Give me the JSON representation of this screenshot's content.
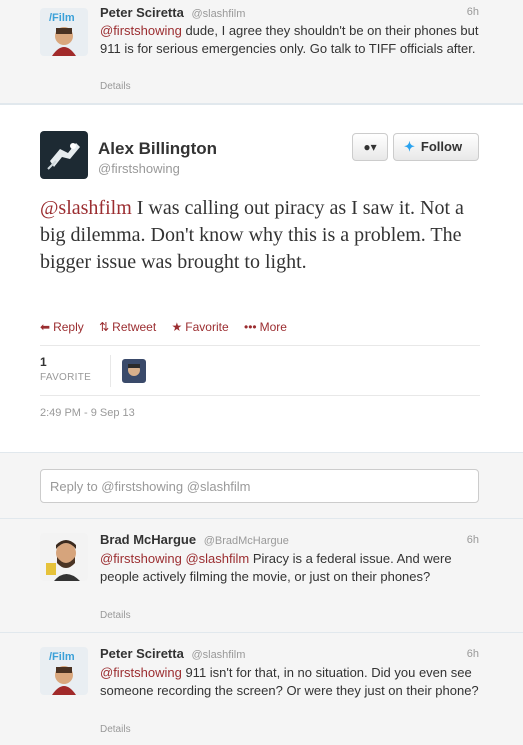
{
  "tweets": [
    {
      "name": "Peter Sciretta",
      "handle": "@slashfilm",
      "time": "6h",
      "mention": "@firstshowing",
      "text": " dude, I agree they shouldn't be on their phones but 911 is for serious emergencies only. Go talk to TIFF officials after.",
      "details": "Details"
    }
  ],
  "main": {
    "name": "Alex Billington",
    "handle": "@firstshowing",
    "user_button": "▾",
    "follow_label": "Follow",
    "mention": "@slashfilm",
    "text": " I was calling out piracy as I saw it. Not a big dilemma. Don't know why this is a problem. The bigger issue was brought to light.",
    "actions": {
      "reply": "Reply",
      "retweet": "Retweet",
      "favorite": "Favorite",
      "more": "More"
    },
    "favorites_count": "1",
    "favorites_label": "FAVORITE",
    "timestamp": "2:49 PM - 9 Sep 13"
  },
  "reply_box": {
    "placeholder": "Reply to @firstshowing @slashfilm"
  },
  "replies": [
    {
      "name": "Brad McHargue",
      "handle": "@BradMcHargue",
      "time": "6h",
      "mention1": "@firstshowing",
      "mention2": "@slashfilm",
      "text": " Piracy is a federal issue. And were people actively filming the movie, or just on their phones?",
      "details": "Details"
    },
    {
      "name": "Peter Sciretta",
      "handle": "@slashfilm",
      "time": "6h",
      "mention1": "@firstshowing",
      "text": " 911 isn't for that, in no situation. Did you even see someone recording the screen? Or were they just on their phone?",
      "details": "Details"
    }
  ],
  "colors": {
    "mention": "#9b2d30",
    "twitter_blue": "#2aa3ef"
  }
}
